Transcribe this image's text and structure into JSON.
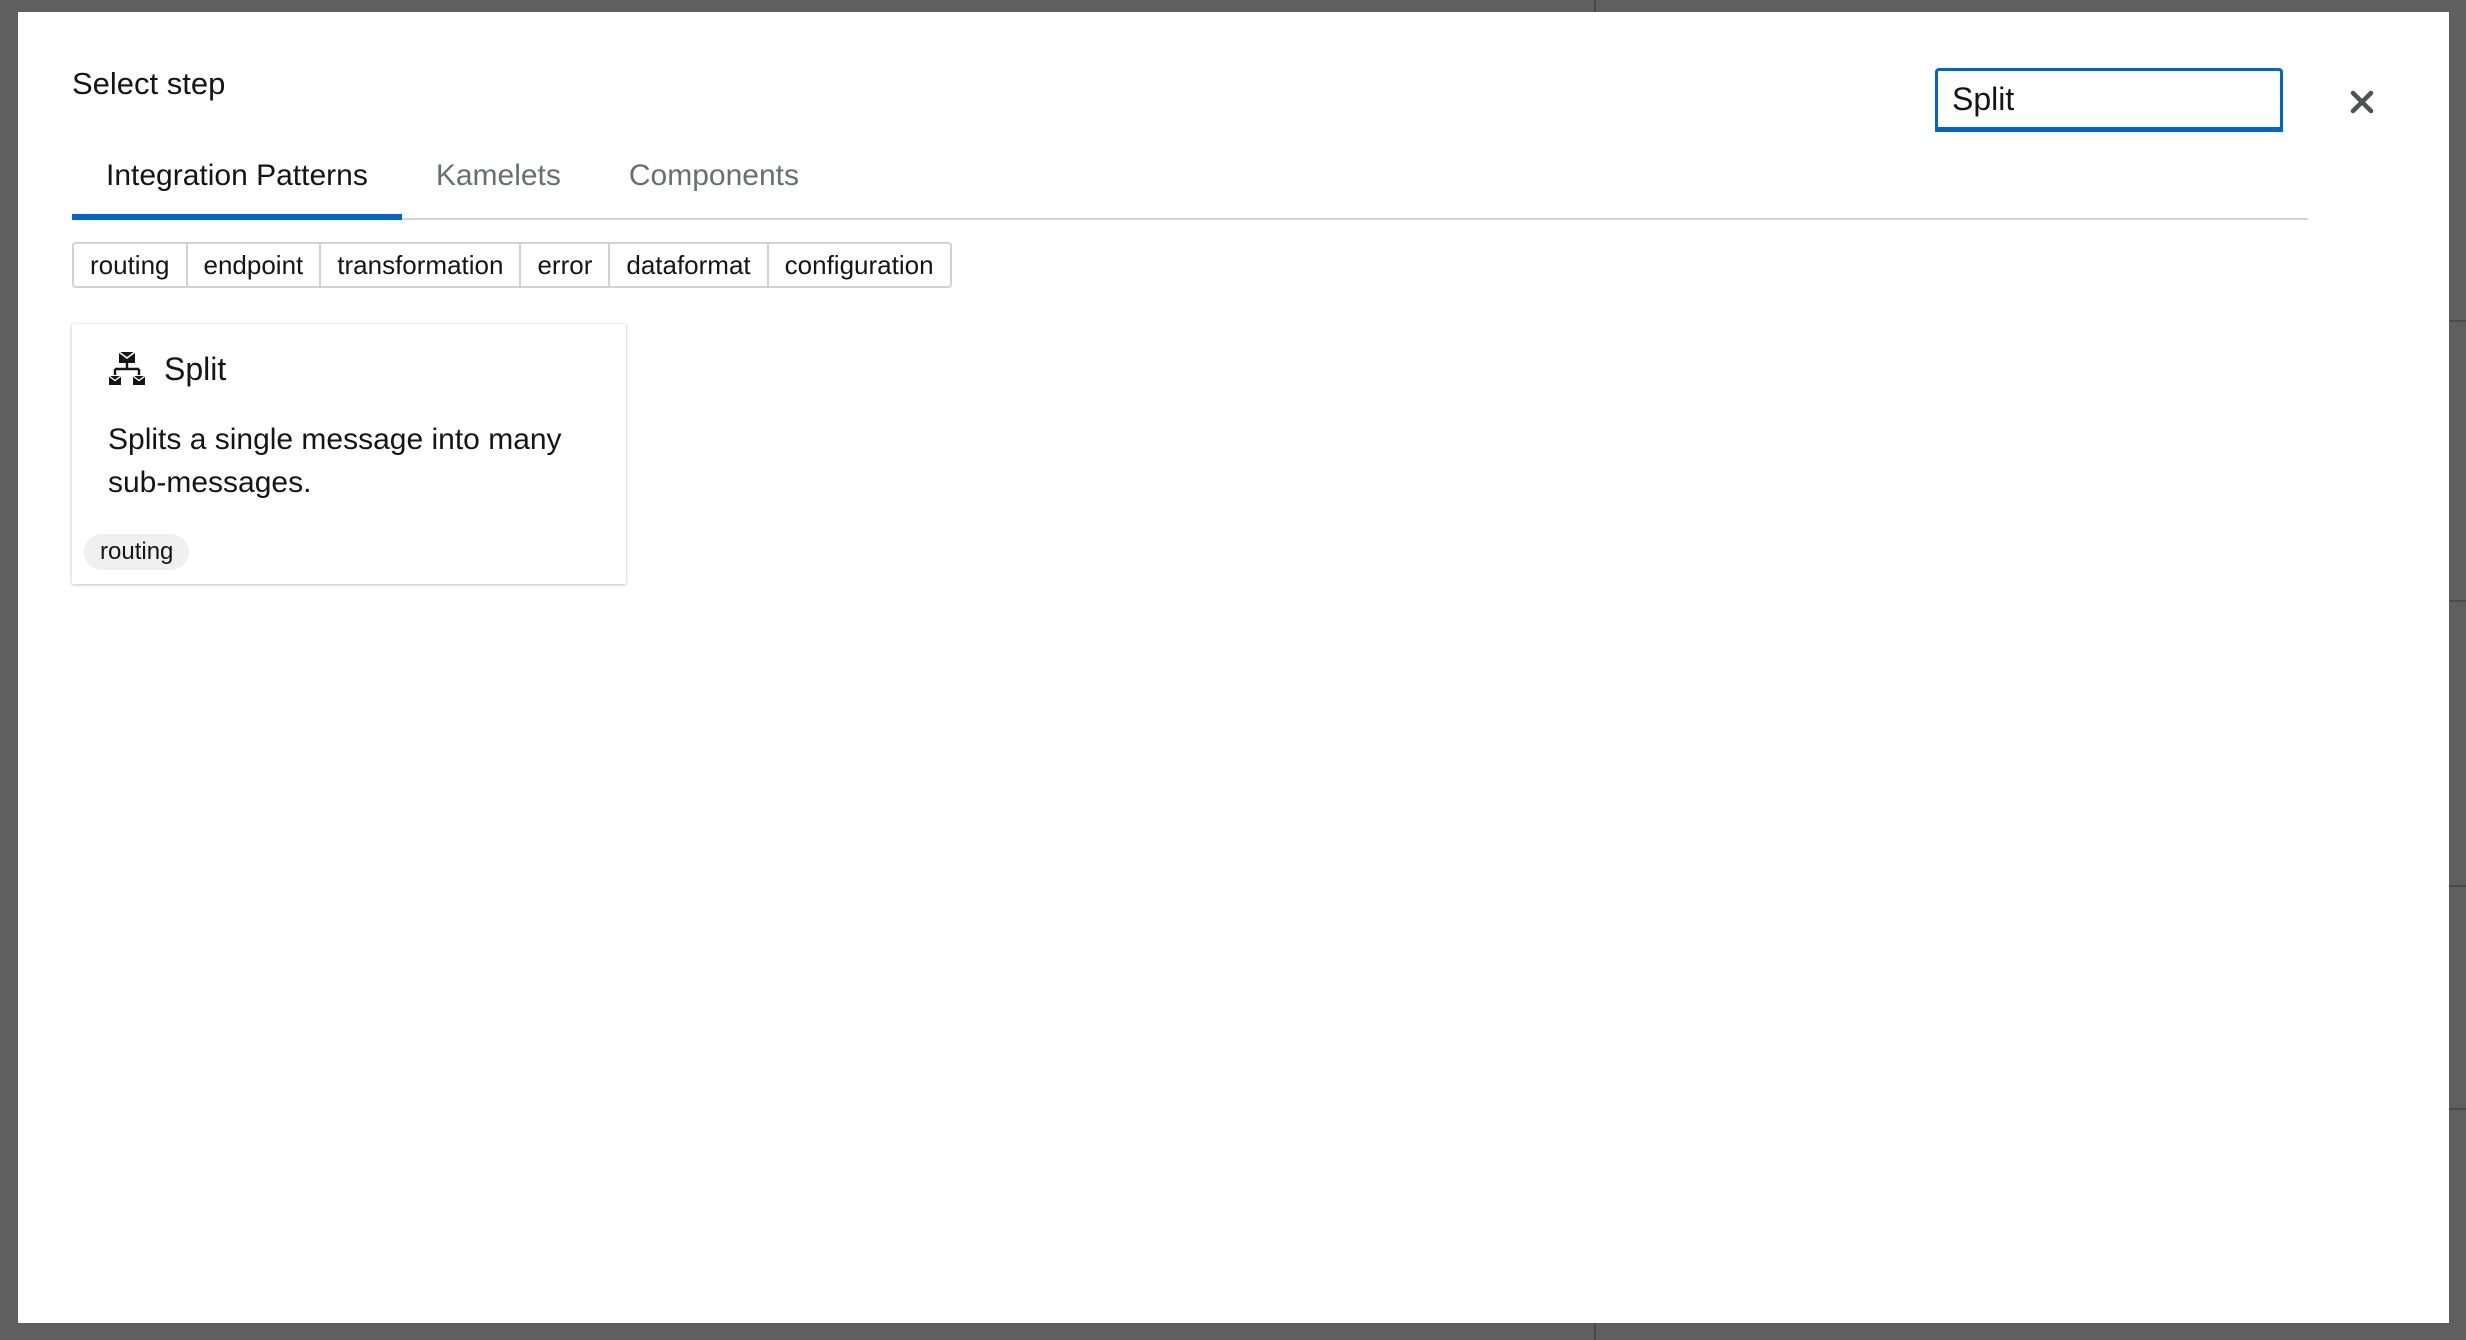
{
  "modal": {
    "title": "Select step",
    "search": {
      "value": "Split",
      "placeholder": ""
    },
    "close_icon": "close-icon"
  },
  "tabs": [
    {
      "label": "Integration Patterns",
      "active": true
    },
    {
      "label": "Kamelets",
      "active": false
    },
    {
      "label": "Components",
      "active": false
    }
  ],
  "filters": [
    "routing",
    "endpoint",
    "transformation",
    "error",
    "dataformat",
    "configuration"
  ],
  "results": [
    {
      "title": "Split",
      "icon": "split-icon",
      "description": "Splits a single message into many sub-messages.",
      "tag": "routing"
    }
  ],
  "colors": {
    "accent": "#0066cc",
    "text": "#151515",
    "muted": "#6a6e73"
  }
}
